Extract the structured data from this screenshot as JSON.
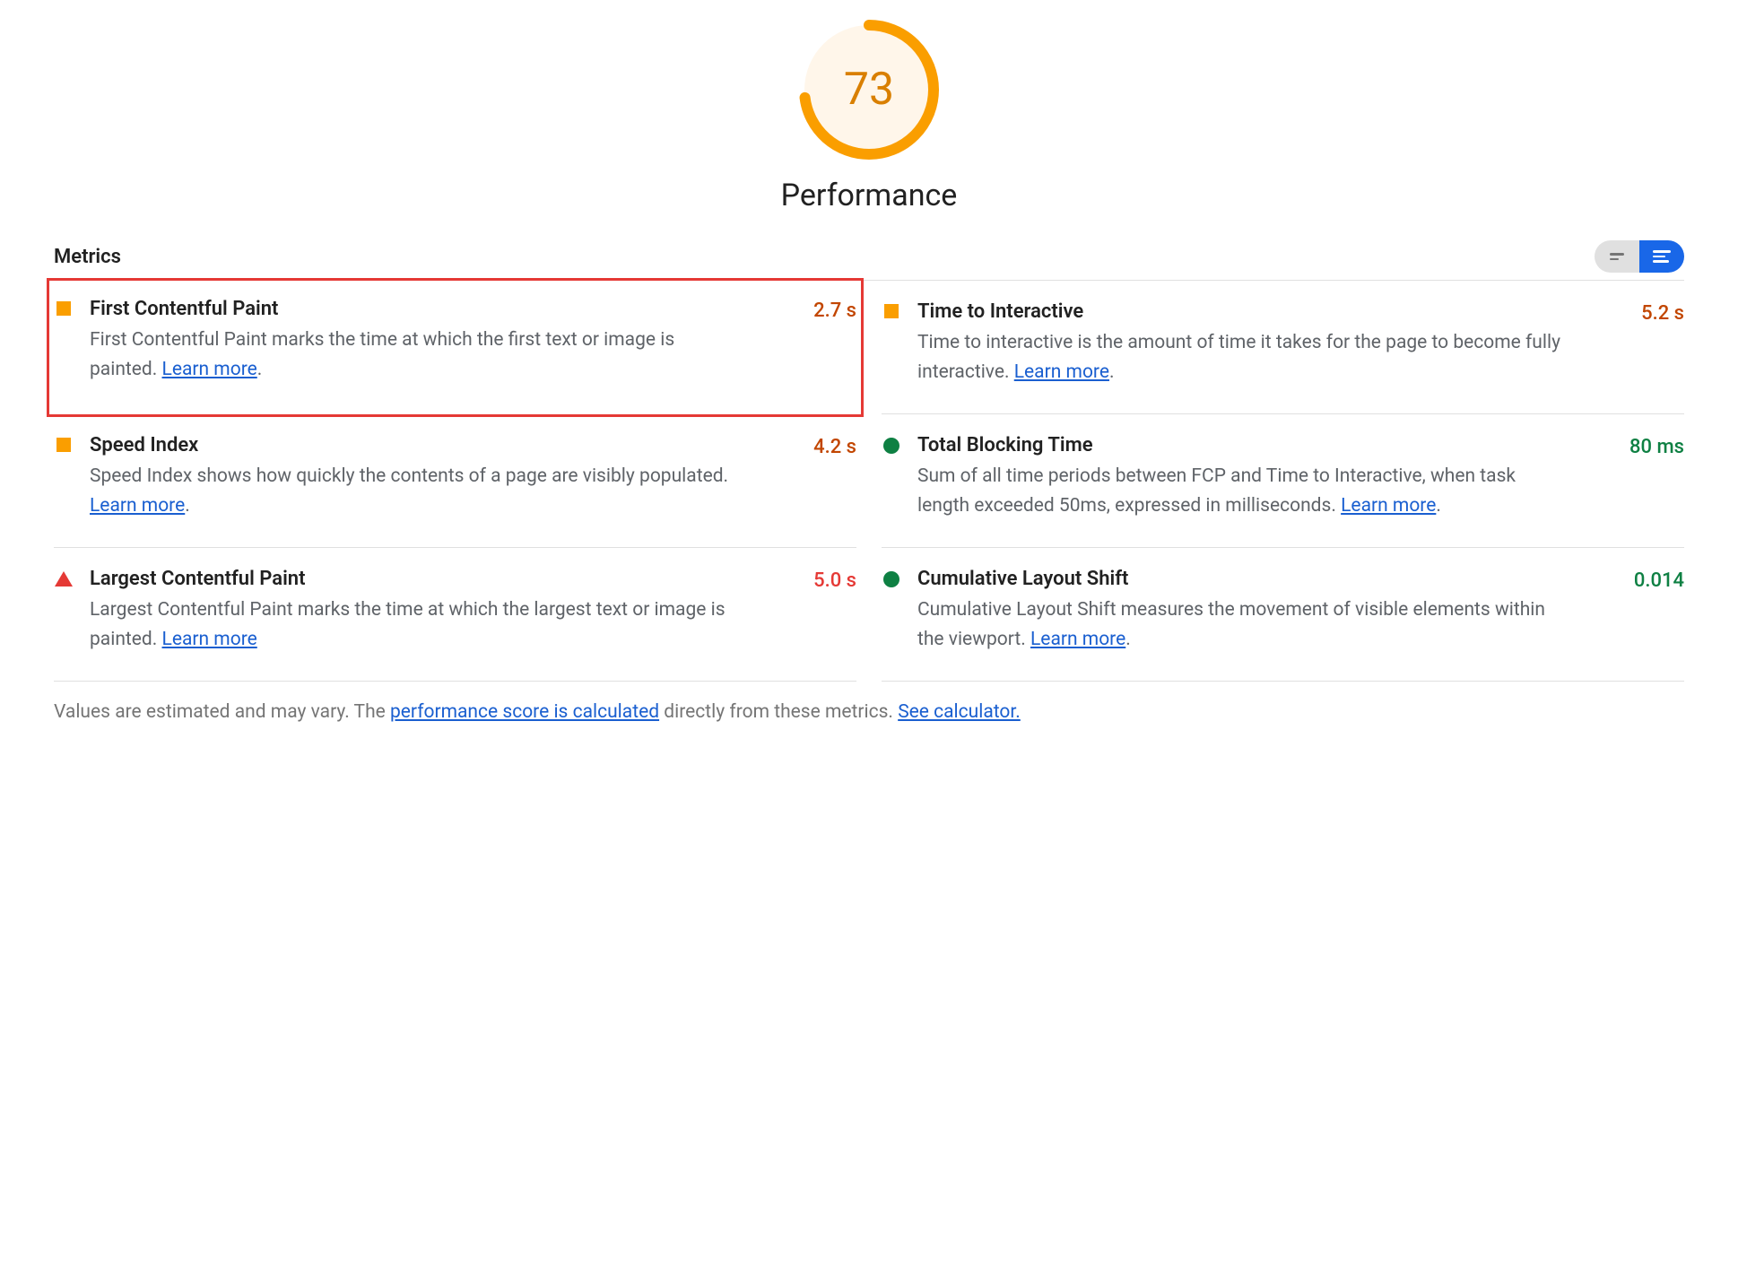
{
  "gauge": {
    "score": "73",
    "title": "Performance",
    "percent": 73,
    "color": "#FA9E00",
    "bg": "#FFF6EA"
  },
  "metrics_header": "Metrics",
  "metrics": [
    {
      "title": "First Contentful Paint",
      "desc_pre": "First Contentful Paint marks the time at which the first text or image is painted. ",
      "learn": "Learn more",
      "desc_post": ".",
      "value": "2.7 s",
      "status": "orange",
      "highlight": true
    },
    {
      "title": "Time to Interactive",
      "desc_pre": "Time to interactive is the amount of time it takes for the page to become fully interactive. ",
      "learn": "Learn more",
      "desc_post": ".",
      "value": "5.2 s",
      "status": "orange",
      "highlight": false
    },
    {
      "title": "Speed Index",
      "desc_pre": "Speed Index shows how quickly the contents of a page are visibly populated. ",
      "learn": "Learn more",
      "desc_post": ".",
      "value": "4.2 s",
      "status": "orange",
      "highlight": false
    },
    {
      "title": "Total Blocking Time",
      "desc_pre": "Sum of all time periods between FCP and Time to Interactive, when task length exceeded 50ms, expressed in milliseconds. ",
      "learn": "Learn more",
      "desc_post": ".",
      "value": "80 ms",
      "status": "green",
      "highlight": false
    },
    {
      "title": "Largest Contentful Paint",
      "desc_pre": "Largest Contentful Paint marks the time at which the largest text or image is painted. ",
      "learn": "Learn more",
      "desc_post": "",
      "value": "5.0 s",
      "status": "red",
      "highlight": false
    },
    {
      "title": "Cumulative Layout Shift",
      "desc_pre": "Cumulative Layout Shift measures the movement of visible elements within the viewport. ",
      "learn": "Learn more",
      "desc_post": ".",
      "value": "0.014",
      "status": "green",
      "highlight": false
    }
  ],
  "footnote": {
    "pre": "Values are estimated and may vary. The ",
    "link1": "performance score is calculated",
    "mid": " directly from these metrics. ",
    "link2": "See calculator."
  }
}
